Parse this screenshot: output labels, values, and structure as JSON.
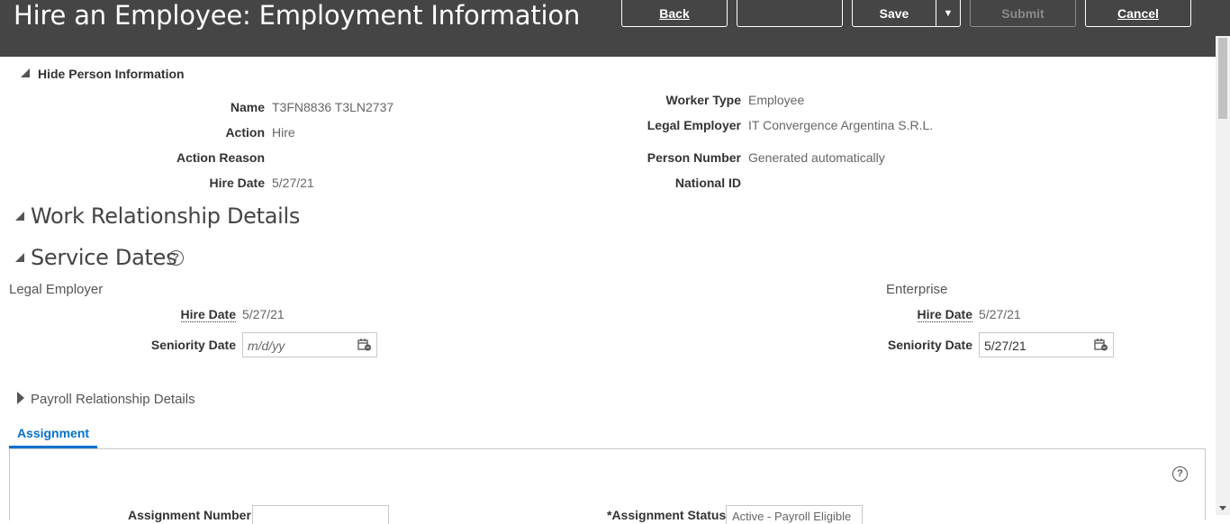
{
  "header": {
    "title": "Hire an Employee: Employment Information",
    "back_label": "Back",
    "blank_label": "",
    "save_label": "Save",
    "save_dropdown": "▼",
    "submit_label": "Submit",
    "cancel_label": "Cancel"
  },
  "person_info": {
    "toggle_label": "Hide Person Information",
    "name_label": "Name",
    "name_value": "T3FN8836 T3LN2737",
    "action_label": "Action",
    "action_value": "Hire",
    "reason_label": "Action Reason",
    "hire_date_label": "Hire Date",
    "hire_date_value": "5/27/21",
    "worker_type_label": "Worker Type",
    "worker_type_value": "Employee",
    "legal_employer_label": "Legal Employer",
    "legal_employer_value": "IT Convergence Argentina S.R.L.",
    "person_number_label": "Person Number",
    "person_number_value": "Generated automatically",
    "national_id_label": "National ID"
  },
  "work_relationship": {
    "title": "Work Relationship Details"
  },
  "service_dates": {
    "title": "Service Dates",
    "help": "?",
    "legal_employer": {
      "heading": "Legal Employer",
      "hire_date_label": "Hire Date",
      "hire_date_value": "5/27/21",
      "seniority_label": "Seniority Date",
      "seniority_placeholder": "m/d/yy"
    },
    "enterprise": {
      "heading": "Enterprise",
      "hire_date_label": "Hire Date",
      "hire_date_value": "5/27/21",
      "seniority_label": "Seniority Date",
      "seniority_value": "5/27/21"
    }
  },
  "payroll": {
    "title": "Payroll Relationship Details"
  },
  "tabs": {
    "assignment": "Assignment"
  },
  "assignment_panel": {
    "help": "?",
    "cut_label_left": "Assignment Number",
    "cut_label_right": "*Assignment Status",
    "cut_value_right": "Active - Payroll Eligible"
  }
}
